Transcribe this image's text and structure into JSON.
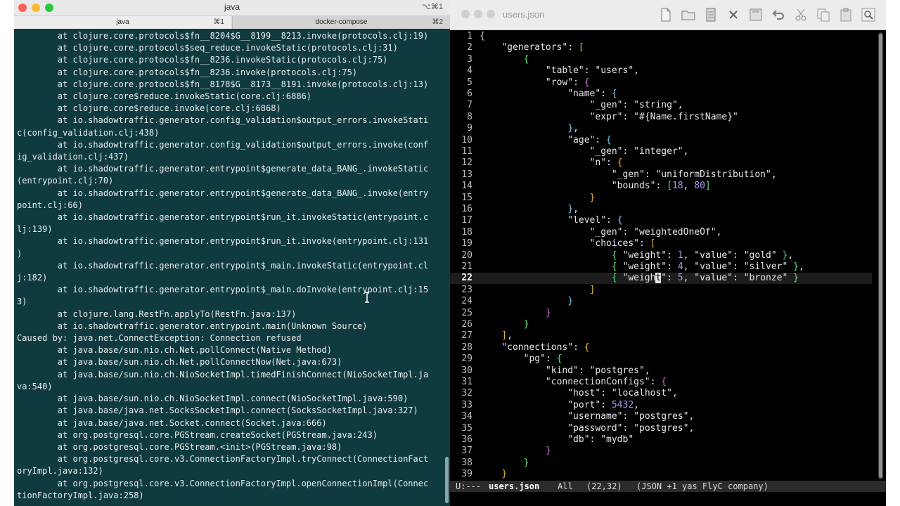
{
  "terminal": {
    "title": "java",
    "shortcut": "⌥⌘1",
    "tabs": [
      {
        "label": "java",
        "key": "⌘1"
      },
      {
        "label": "docker-compose",
        "key": "⌘2"
      }
    ],
    "output": "        at clojure.core.protocols$fn__8204$G__8199__8213.invoke(protocols.clj:19)\n        at clojure.core.protocols$seq_reduce.invokeStatic(protocols.clj:31)\n        at clojure.core.protocols$fn__8236.invokeStatic(protocols.clj:75)\n        at clojure.core.protocols$fn__8236.invoke(protocols.clj:75)\n        at clojure.core.protocols$fn__8178$G__8173__8191.invoke(protocols.clj:13)\n        at clojure.core$reduce.invokeStatic(core.clj:6886)\n        at clojure.core$reduce.invoke(core.clj:6868)\n        at io.shadowtraffic.generator.config_validation$output_errors.invokeStati\nc(config_validation.clj:438)\n        at io.shadowtraffic.generator.config_validation$output_errors.invoke(conf\nig_validation.clj:437)\n        at io.shadowtraffic.generator.entrypoint$generate_data_BANG_.invokeStatic\n(entrypoint.clj:70)\n        at io.shadowtraffic.generator.entrypoint$generate_data_BANG_.invoke(entry\npoint.clj:66)\n        at io.shadowtraffic.generator.entrypoint$run_it.invokeStatic(entrypoint.c\nlj:139)\n        at io.shadowtraffic.generator.entrypoint$run_it.invoke(entrypoint.clj:131\n)\n        at io.shadowtraffic.generator.entrypoint$_main.invokeStatic(entrypoint.cl\nj:182)\n        at io.shadowtraffic.generator.entrypoint$_main.doInvoke(entrypoint.clj:15\n3)\n        at clojure.lang.RestFn.applyTo(RestFn.java:137)\n        at io.shadowtraffic.generator.entrypoint.main(Unknown Source)\nCaused by: java.net.ConnectException: Connection refused\n        at java.base/sun.nio.ch.Net.pollConnect(Native Method)\n        at java.base/sun.nio.ch.Net.pollConnectNow(Net.java:673)\n        at java.base/sun.nio.ch.NioSocketImpl.timedFinishConnect(NioSocketImpl.ja\nva:540)\n        at java.base/sun.nio.ch.NioSocketImpl.connect(NioSocketImpl.java:590)\n        at java.base/java.net.SocksSocketImpl.connect(SocksSocketImpl.java:327)\n        at java.base/java.net.Socket.connect(Socket.java:666)\n        at org.postgresql.core.PGStream.createSocket(PGStream.java:243)\n        at org.postgresql.core.PGStream.<init>(PGStream.java:98)\n        at org.postgresql.core.v3.ConnectionFactoryImpl.tryConnect(ConnectionFact\noryImpl.java:132)\n        at org.postgresql.core.v3.ConnectionFactoryImpl.openConnectionImpl(Connec\ntionFactoryImpl.java:258)"
  },
  "emacs": {
    "title": "users.json",
    "toolbar": [
      "new-file",
      "open-folder",
      "open-file",
      "close",
      "save",
      "undo",
      "cut",
      "copy",
      "paste",
      "search"
    ],
    "lines": [
      {
        "n": "1",
        "parts": [
          [
            "b1",
            "{"
          ]
        ]
      },
      {
        "n": "2",
        "parts": [
          [
            "p",
            "    "
          ],
          [
            "s",
            "\"generators\""
          ],
          [
            "p",
            ": "
          ],
          [
            "b2",
            "["
          ]
        ]
      },
      {
        "n": "3",
        "parts": [
          [
            "p",
            "        "
          ],
          [
            "b3",
            "{"
          ]
        ]
      },
      {
        "n": "4",
        "parts": [
          [
            "p",
            "            "
          ],
          [
            "s",
            "\"table\""
          ],
          [
            "p",
            ": "
          ],
          [
            "s",
            "\"users\""
          ],
          [
            "p",
            ","
          ]
        ]
      },
      {
        "n": "5",
        "parts": [
          [
            "p",
            "            "
          ],
          [
            "s",
            "\"row\""
          ],
          [
            "p",
            ": "
          ],
          [
            "b4",
            "{"
          ]
        ]
      },
      {
        "n": "6",
        "parts": [
          [
            "p",
            "                "
          ],
          [
            "s",
            "\"name\""
          ],
          [
            "p",
            ": "
          ],
          [
            "b5",
            "{"
          ]
        ]
      },
      {
        "n": "7",
        "parts": [
          [
            "p",
            "                    "
          ],
          [
            "s",
            "\"_gen\""
          ],
          [
            "p",
            ": "
          ],
          [
            "s",
            "\"string\""
          ],
          [
            "p",
            ","
          ]
        ]
      },
      {
        "n": "8",
        "parts": [
          [
            "p",
            "                    "
          ],
          [
            "s",
            "\"expr\""
          ],
          [
            "p",
            ": "
          ],
          [
            "s",
            "\"#{Name.firstName}\""
          ]
        ]
      },
      {
        "n": "9",
        "parts": [
          [
            "p",
            "                "
          ],
          [
            "b5",
            "}"
          ],
          [
            "p",
            ","
          ]
        ]
      },
      {
        "n": "10",
        "parts": [
          [
            "p",
            "                "
          ],
          [
            "s",
            "\"age\""
          ],
          [
            "p",
            ": "
          ],
          [
            "b5",
            "{"
          ]
        ]
      },
      {
        "n": "11",
        "parts": [
          [
            "p",
            "                    "
          ],
          [
            "s",
            "\"_gen\""
          ],
          [
            "p",
            ": "
          ],
          [
            "s",
            "\"integer\""
          ],
          [
            "p",
            ","
          ]
        ]
      },
      {
        "n": "12",
        "parts": [
          [
            "p",
            "                    "
          ],
          [
            "s",
            "\"n\""
          ],
          [
            "p",
            ": "
          ],
          [
            "b6",
            "{"
          ]
        ]
      },
      {
        "n": "13",
        "parts": [
          [
            "p",
            "                        "
          ],
          [
            "s",
            "\"_gen\""
          ],
          [
            "p",
            ": "
          ],
          [
            "s",
            "\"uniformDistribution\""
          ],
          [
            "p",
            ","
          ]
        ]
      },
      {
        "n": "14",
        "parts": [
          [
            "p",
            "                        "
          ],
          [
            "s",
            "\"bounds\""
          ],
          [
            "p",
            ": "
          ],
          [
            "b3",
            "["
          ],
          [
            "n",
            "18"
          ],
          [
            "p",
            ", "
          ],
          [
            "n",
            "80"
          ],
          [
            "b3",
            "]"
          ]
        ]
      },
      {
        "n": "15",
        "parts": [
          [
            "p",
            "                    "
          ],
          [
            "b6",
            "}"
          ]
        ]
      },
      {
        "n": "16",
        "parts": [
          [
            "p",
            "                "
          ],
          [
            "b5",
            "}"
          ],
          [
            "p",
            ","
          ]
        ]
      },
      {
        "n": "17",
        "parts": [
          [
            "p",
            "                "
          ],
          [
            "s",
            "\"level\""
          ],
          [
            "p",
            ": "
          ],
          [
            "b5",
            "{"
          ]
        ]
      },
      {
        "n": "18",
        "parts": [
          [
            "p",
            "                    "
          ],
          [
            "s",
            "\"_gen\""
          ],
          [
            "p",
            ": "
          ],
          [
            "s",
            "\"weightedOneOf\""
          ],
          [
            "p",
            ","
          ]
        ]
      },
      {
        "n": "19",
        "parts": [
          [
            "p",
            "                    "
          ],
          [
            "s",
            "\"choices\""
          ],
          [
            "p",
            ": "
          ],
          [
            "b6",
            "["
          ]
        ]
      },
      {
        "n": "20",
        "parts": [
          [
            "p",
            "                        "
          ],
          [
            "b3",
            "{"
          ],
          [
            "p",
            " "
          ],
          [
            "s",
            "\"weight\""
          ],
          [
            "p",
            ": "
          ],
          [
            "n",
            "1"
          ],
          [
            "p",
            ", "
          ],
          [
            "s",
            "\"value\""
          ],
          [
            "p",
            ": "
          ],
          [
            "s",
            "\"gold\""
          ],
          [
            "p",
            " "
          ],
          [
            "b3",
            "}"
          ],
          [
            "p",
            ","
          ]
        ]
      },
      {
        "n": "21",
        "parts": [
          [
            "p",
            "                        "
          ],
          [
            "b3",
            "{"
          ],
          [
            "p",
            " "
          ],
          [
            "s",
            "\"weight\""
          ],
          [
            "p",
            ": "
          ],
          [
            "n",
            "4"
          ],
          [
            "p",
            ", "
          ],
          [
            "s",
            "\"value\""
          ],
          [
            "p",
            ": "
          ],
          [
            "s",
            "\"silver\""
          ],
          [
            "p",
            " "
          ],
          [
            "b3",
            "}"
          ],
          [
            "p",
            ","
          ]
        ]
      },
      {
        "n": "22",
        "parts": [
          [
            "p",
            "                        "
          ],
          [
            "b3",
            "{"
          ],
          [
            "p",
            " "
          ],
          [
            "s",
            "\"weigh"
          ],
          [
            "cursorbox",
            "t"
          ],
          [
            "s",
            "\""
          ],
          [
            "p",
            ": "
          ],
          [
            "n",
            "5"
          ],
          [
            "p",
            ", "
          ],
          [
            "s",
            "\"value\""
          ],
          [
            "p",
            ": "
          ],
          [
            "s",
            "\"bronze\""
          ],
          [
            "p",
            " "
          ],
          [
            "b3",
            "}"
          ]
        ]
      },
      {
        "n": "23",
        "parts": [
          [
            "p",
            "                    "
          ],
          [
            "b6",
            "]"
          ]
        ]
      },
      {
        "n": "24",
        "parts": [
          [
            "p",
            "                "
          ],
          [
            "b5",
            "}"
          ]
        ]
      },
      {
        "n": "25",
        "parts": [
          [
            "p",
            "            "
          ],
          [
            "b4",
            "}"
          ]
        ]
      },
      {
        "n": "26",
        "parts": [
          [
            "p",
            "        "
          ],
          [
            "b3",
            "}"
          ]
        ]
      },
      {
        "n": "27",
        "parts": [
          [
            "p",
            "    "
          ],
          [
            "b2",
            "]"
          ],
          [
            "p",
            ","
          ]
        ]
      },
      {
        "n": "28",
        "parts": [
          [
            "p",
            "    "
          ],
          [
            "s",
            "\"connections\""
          ],
          [
            "p",
            ": "
          ],
          [
            "b2",
            "{"
          ]
        ]
      },
      {
        "n": "29",
        "parts": [
          [
            "p",
            "        "
          ],
          [
            "s",
            "\"pg\""
          ],
          [
            "p",
            ": "
          ],
          [
            "b3",
            "{"
          ]
        ]
      },
      {
        "n": "30",
        "parts": [
          [
            "p",
            "            "
          ],
          [
            "s",
            "\"kind\""
          ],
          [
            "p",
            ": "
          ],
          [
            "s",
            "\"postgres\""
          ],
          [
            "p",
            ","
          ]
        ]
      },
      {
        "n": "31",
        "parts": [
          [
            "p",
            "            "
          ],
          [
            "s",
            "\"connectionConfigs\""
          ],
          [
            "p",
            ": "
          ],
          [
            "b4",
            "{"
          ]
        ]
      },
      {
        "n": "32",
        "parts": [
          [
            "p",
            "                "
          ],
          [
            "s",
            "\"host\""
          ],
          [
            "p",
            ": "
          ],
          [
            "s",
            "\"localhost\""
          ],
          [
            "p",
            ","
          ]
        ]
      },
      {
        "n": "33",
        "parts": [
          [
            "p",
            "                "
          ],
          [
            "s",
            "\"port\""
          ],
          [
            "p",
            ": "
          ],
          [
            "n",
            "5432"
          ],
          [
            "p",
            ","
          ]
        ]
      },
      {
        "n": "34",
        "parts": [
          [
            "p",
            "                "
          ],
          [
            "s",
            "\"username\""
          ],
          [
            "p",
            ": "
          ],
          [
            "s",
            "\"postgres\""
          ],
          [
            "p",
            ","
          ]
        ]
      },
      {
        "n": "35",
        "parts": [
          [
            "p",
            "                "
          ],
          [
            "s",
            "\"password\""
          ],
          [
            "p",
            ": "
          ],
          [
            "s",
            "\"postgres\""
          ],
          [
            "p",
            ","
          ]
        ]
      },
      {
        "n": "36",
        "parts": [
          [
            "p",
            "                "
          ],
          [
            "s",
            "\"db\""
          ],
          [
            "p",
            ": "
          ],
          [
            "s",
            "\"mydb\""
          ]
        ]
      },
      {
        "n": "37",
        "parts": [
          [
            "p",
            "            "
          ],
          [
            "b4",
            "}"
          ]
        ]
      },
      {
        "n": "38",
        "parts": [
          [
            "p",
            "        "
          ],
          [
            "b3",
            "}"
          ]
        ]
      },
      {
        "n": "39",
        "parts": [
          [
            "p",
            "    "
          ],
          [
            "b2",
            "}"
          ]
        ]
      }
    ],
    "current_line": "22",
    "modeline": {
      "status": "U:---",
      "buffer": "users.json",
      "position": "All",
      "cursor": "(22,32)",
      "modes": "(JSON +1 yas FlyC company)"
    }
  }
}
